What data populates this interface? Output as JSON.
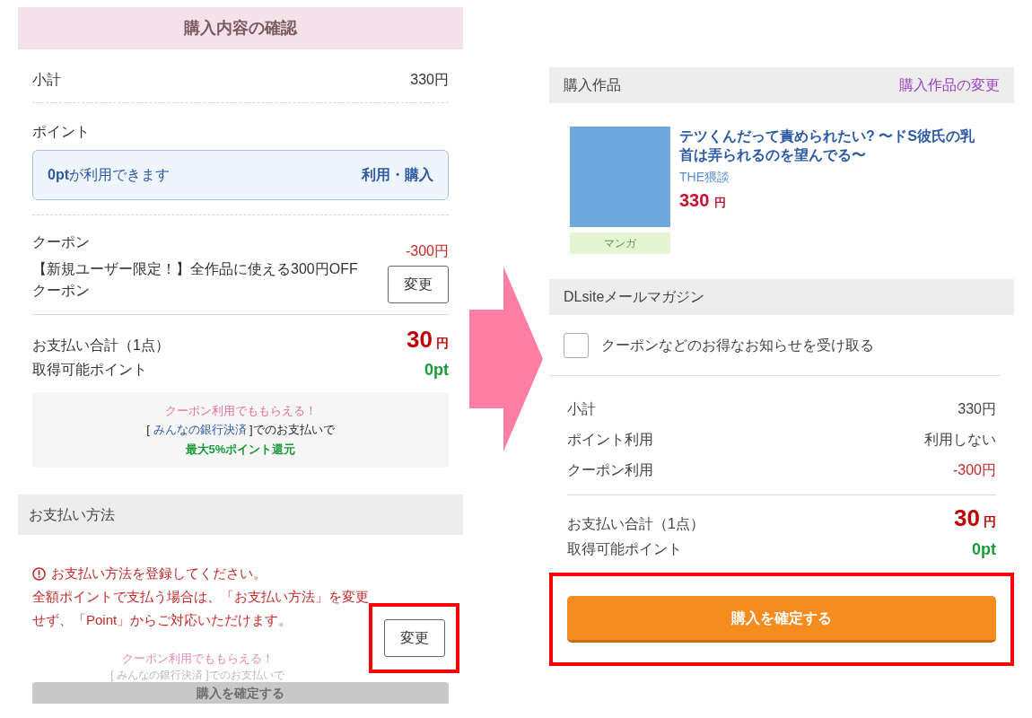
{
  "left": {
    "title": "購入内容の確認",
    "subtotal": {
      "label": "小計",
      "value": "330円"
    },
    "points": {
      "label": "ポイント",
      "available": "**0pt**が利用できます",
      "action": "利用・購入"
    },
    "coupon": {
      "label": "クーポン",
      "amount": "-300円",
      "description": "【新規ユーザー限定！】全作品に使える300円OFFクーポン",
      "button": "変更"
    },
    "total": {
      "label": "お支払い合計（1点）",
      "amount": "30",
      "unit": "円"
    },
    "earned": {
      "label": "取得可能ポイント",
      "value": "0pt"
    },
    "promo": {
      "headline": "クーポン利用でももらえる！",
      "prefix": "[ ",
      "link": "みんなの銀行決済",
      "suffix": " ]でのお支払いで",
      "bonus": "最大5%ポイント還元"
    },
    "payment": {
      "header": "お支払い方法",
      "warning": "お支払い方法を登録してください。",
      "message": "全額ポイントで支払う場合は、「お支払い方法」を変更せず、「Point」からご対応いただけます。",
      "button": {
        "label": "変更",
        "highlighted": true
      }
    },
    "faded": {
      "headline": "クーポン利用でももらえる！",
      "line": "[ みんなの銀行決済 ]でのお支払いで",
      "button": {
        "label": "購入を確定する",
        "disabled": true
      }
    }
  },
  "right": {
    "works": {
      "header": "購入作品",
      "change": "購入作品の変更"
    },
    "product": {
      "title": "テツくんだって責められたい? 〜ドS彼氏の乳首は弄られるのを望んでる〜",
      "circle": "THE猥談",
      "price": "330",
      "unit": "円",
      "tag": "マンガ"
    },
    "mail": {
      "header": "DLsiteメールマガジン",
      "checkbox": {
        "label": "クーポンなどのお得なお知らせを受け取る",
        "checked": false
      }
    },
    "summary": [
      {
        "label": "小計",
        "value": "330円",
        "kind": "normal"
      },
      {
        "label": "ポイント利用",
        "value": "利用しない",
        "kind": "normal"
      },
      {
        "label": "クーポン利用",
        "value": "-300円",
        "kind": "discount"
      }
    ],
    "total": {
      "label": "お支払い合計（1点）",
      "amount": "30",
      "unit": "円"
    },
    "earned": {
      "label": "取得可能ポイント",
      "value": "0pt"
    },
    "confirm": {
      "label": "購入を確定する",
      "highlighted": true,
      "disabled": false
    }
  }
}
